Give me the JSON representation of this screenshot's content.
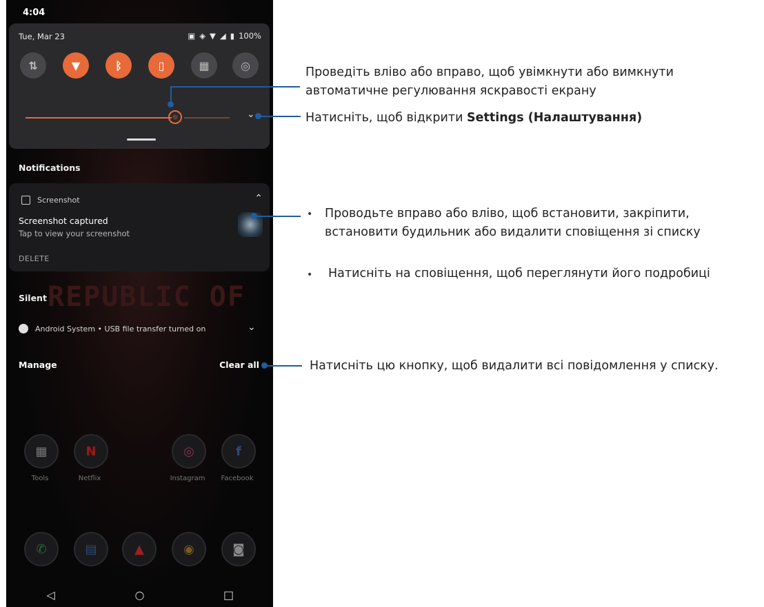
{
  "phone": {
    "time": "4:04",
    "date": "Tue, Mar 23",
    "battery": "100%",
    "wallpaper_text": "REPUBLIC OF",
    "notifications_header": "Notifications",
    "notification": {
      "app": "Screenshot",
      "title": "Screenshot captured",
      "text": "Tap to view your screenshot",
      "action": "DELETE"
    },
    "silent_header": "Silent",
    "silent_item": "Android System • USB file transfer turned on",
    "manage": "Manage",
    "clear_all": "Clear all",
    "apps": [
      "Tools",
      "Netflix",
      "Instagram",
      "Facebook"
    ]
  },
  "callouts": {
    "brightness_line1": "Проведіть вліво або вправо, щоб увімкнути або вимкнути",
    "brightness_line2": "автоматичне регулювання яскравості екрану",
    "settings_prefix": "Натисніть, щоб відкрити ",
    "settings_bold": "Settings (Налаштування)",
    "swipe_line1": "Проводьте вправо або вліво, щоб встановити, закріпити,",
    "swipe_line2": "встановити будильник або видалити сповіщення зі списку",
    "tap_details": "Натисніть на сповіщення, щоб переглянути його подробиці",
    "clear_all_desc": "Натисніть цю кнопку, щоб видалити всі повідомлення у списку."
  },
  "colors": {
    "accent": "#e86a3a",
    "callout_line": "#1f5d9e"
  }
}
